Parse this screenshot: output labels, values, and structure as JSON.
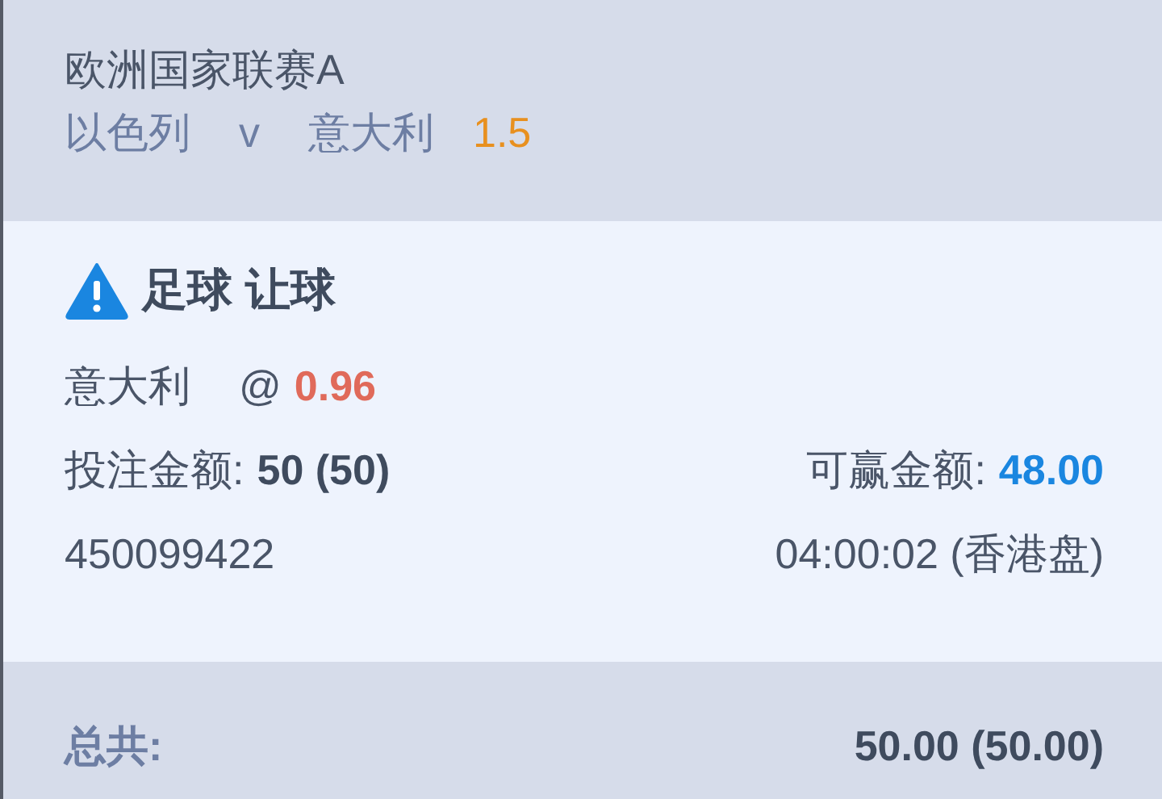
{
  "header": {
    "league": "欧洲国家联赛A",
    "home": "以色列",
    "versus": "v",
    "away": "意大利",
    "handicap": "1.5"
  },
  "bet": {
    "title": "足球 让球",
    "selection": "意大利",
    "at": "@",
    "odds": "0.96",
    "stake_label": "投注金额:",
    "stake": "50 (50)",
    "win_label": "可赢金额:",
    "win": "48.00",
    "ticket": "450099422",
    "time": "04:00:02 (香港盘)"
  },
  "total": {
    "label": "总共:",
    "value": "50.00 (50.00)"
  }
}
